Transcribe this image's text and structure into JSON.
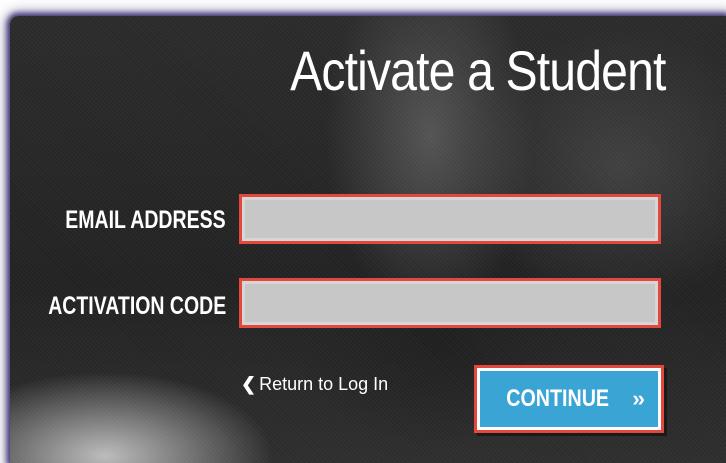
{
  "form": {
    "title": "Activate a Student",
    "email_label": "EMAIL ADDRESS",
    "email_value": "",
    "activation_code_label": "ACTIVATION CODE",
    "activation_code_value": "",
    "return_link_icon": "chevron-left-icon",
    "return_link_label": "Return to Log In",
    "continue_label": "CONTINUE",
    "continue_icon": "double-chevron-right-icon"
  },
  "colors": {
    "panel_background": "#222222",
    "field_border_highlight": "#e4483d",
    "field_fill": "#c7c7c7",
    "continue_button": "#3aa5d5",
    "text": "#ffffff"
  }
}
